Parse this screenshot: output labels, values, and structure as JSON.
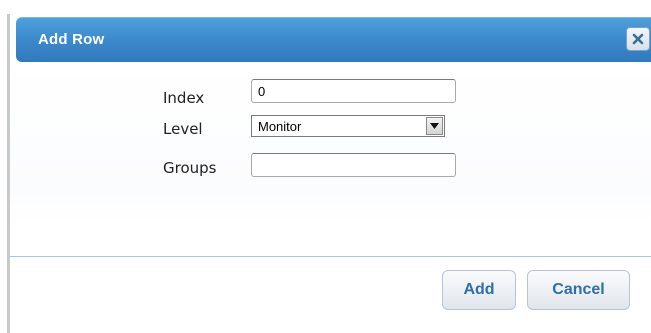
{
  "dialog": {
    "title": "Add Row",
    "close_icon": "close-x-icon"
  },
  "form": {
    "index": {
      "label": "Index",
      "value": "0",
      "placeholder": ""
    },
    "level": {
      "label": "Level",
      "selected": "Monitor"
    },
    "groups": {
      "label": "Groups",
      "value": "",
      "placeholder": ""
    }
  },
  "buttons": {
    "add_label": "Add",
    "cancel_label": "Cancel"
  },
  "colors": {
    "titlebar": "#3a88ca",
    "button_text": "#2f6fa8",
    "divider": "#a9c7e4"
  }
}
